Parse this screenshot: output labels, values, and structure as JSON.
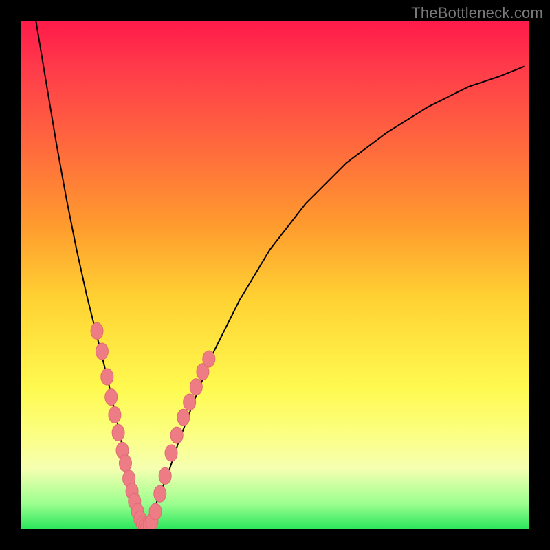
{
  "watermark": "TheBottleneck.com",
  "colors": {
    "frame": "#000000",
    "curve": "#000000",
    "dot_fill": "#ed7c84",
    "dot_stroke": "#e06a74",
    "gradient_stops": [
      {
        "pos": 0.0,
        "hex": "#ff1a4a"
      },
      {
        "pos": 0.1,
        "hex": "#ff3d4a"
      },
      {
        "pos": 0.25,
        "hex": "#ff6a3d"
      },
      {
        "pos": 0.4,
        "hex": "#ff9a2e"
      },
      {
        "pos": 0.55,
        "hex": "#ffd333"
      },
      {
        "pos": 0.72,
        "hex": "#fff94f"
      },
      {
        "pos": 0.8,
        "hex": "#fcff7a"
      },
      {
        "pos": 0.88,
        "hex": "#f6ffb0"
      },
      {
        "pos": 0.95,
        "hex": "#9bff8f"
      },
      {
        "pos": 1.0,
        "hex": "#28e65b"
      }
    ]
  },
  "chart_data": {
    "type": "line",
    "title": "",
    "xlabel": "",
    "ylabel": "",
    "xlim": [
      0,
      100
    ],
    "ylim": [
      0,
      100
    ],
    "grid": false,
    "legend": false,
    "series": [
      {
        "name": "left-branch",
        "x": [
          3,
          5,
          7,
          9,
          11,
          13,
          15,
          17,
          19,
          20.5,
          21.5,
          22.5,
          23.5,
          24.5
        ],
        "y": [
          100,
          88,
          76,
          65,
          55,
          46,
          38,
          30,
          21,
          14,
          9,
          5,
          2,
          0
        ]
      },
      {
        "name": "right-branch",
        "x": [
          24.5,
          25.5,
          27,
          29,
          31,
          34,
          38,
          43,
          49,
          56,
          64,
          72,
          80,
          88,
          94,
          99
        ],
        "y": [
          0,
          2,
          6,
          11,
          17,
          25,
          35,
          45,
          55,
          64,
          72,
          78,
          83,
          87,
          89,
          91
        ]
      }
    ],
    "scatter_overlay": {
      "name": "highlighted-points",
      "points": [
        {
          "x": 15.0,
          "y": 39.0
        },
        {
          "x": 16.0,
          "y": 35.0
        },
        {
          "x": 17.0,
          "y": 30.0
        },
        {
          "x": 17.8,
          "y": 26.0
        },
        {
          "x": 18.5,
          "y": 22.5
        },
        {
          "x": 19.2,
          "y": 19.0
        },
        {
          "x": 20.0,
          "y": 15.5
        },
        {
          "x": 20.6,
          "y": 13.0
        },
        {
          "x": 21.3,
          "y": 10.0
        },
        {
          "x": 21.9,
          "y": 7.5
        },
        {
          "x": 22.4,
          "y": 5.5
        },
        {
          "x": 23.0,
          "y": 3.5
        },
        {
          "x": 23.5,
          "y": 2.0
        },
        {
          "x": 24.0,
          "y": 1.0
        },
        {
          "x": 24.4,
          "y": 0.5
        },
        {
          "x": 24.8,
          "y": 0.3
        },
        {
          "x": 25.3,
          "y": 0.7
        },
        {
          "x": 25.8,
          "y": 1.5
        },
        {
          "x": 26.5,
          "y": 3.5
        },
        {
          "x": 27.4,
          "y": 7.0
        },
        {
          "x": 28.4,
          "y": 10.5
        },
        {
          "x": 29.6,
          "y": 15.0
        },
        {
          "x": 30.7,
          "y": 18.5
        },
        {
          "x": 32.0,
          "y": 22.0
        },
        {
          "x": 33.2,
          "y": 25.0
        },
        {
          "x": 34.5,
          "y": 28.0
        },
        {
          "x": 35.8,
          "y": 31.0
        },
        {
          "x": 37.0,
          "y": 33.5
        }
      ]
    }
  }
}
